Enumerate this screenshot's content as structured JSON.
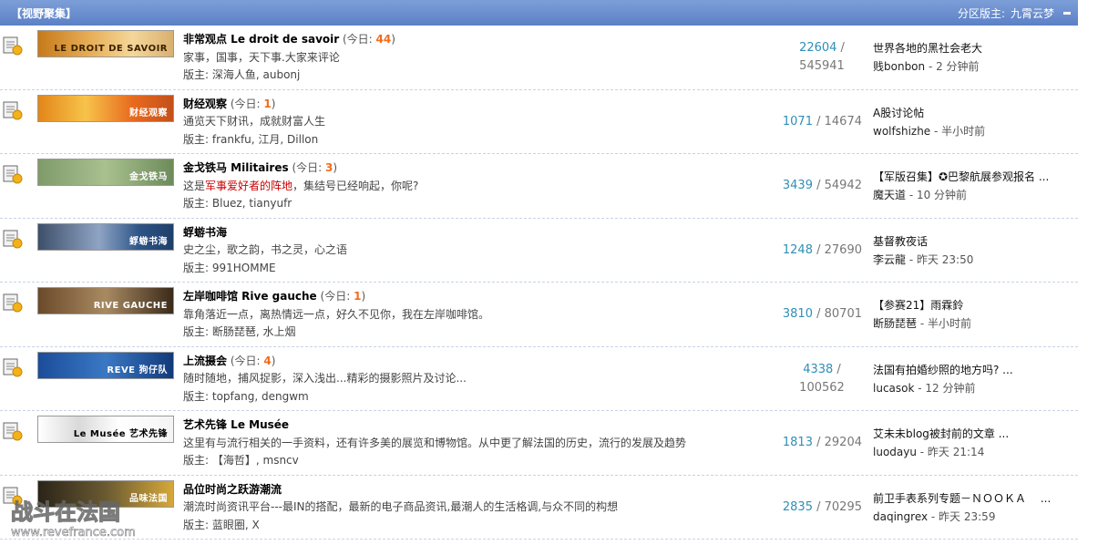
{
  "category": {
    "title": "【视野聚集】",
    "moderators_label": "分区版主:",
    "moderators": "九霄云梦"
  },
  "forums": [
    {
      "name": "非常观点 Le droit de savoir",
      "today_prefix": "(今日: ",
      "today": "44",
      "today_suffix": ")",
      "desc_parts": [
        "家事，国事，天下事.大家来评论"
      ],
      "mods_label": "版主:",
      "mods": "深海人鱼, aubonj",
      "topics": "22604",
      "posts": "545941",
      "last_title": "世界各地的黑社会老大",
      "last_user": "贱bonbon",
      "last_time": "- 2 分钟前",
      "banner_text": "LE DROIT DE SAVOIR"
    },
    {
      "name": "财经观察",
      "today_prefix": "(今日: ",
      "today": "1",
      "today_suffix": ")",
      "desc_parts": [
        "通览天下财讯，成就财富人生"
      ],
      "mods_label": "版主:",
      "mods": "frankfu, 江月, Dillon",
      "topics": "1071",
      "posts": "14674",
      "last_title": "A股讨论帖",
      "last_user": "wolfshizhe",
      "last_time": "- 半小时前",
      "banner_text": "财经观察"
    },
    {
      "name": "金戈铁马 Militaires",
      "today_prefix": "(今日: ",
      "today": "3",
      "today_suffix": ")",
      "desc_parts": [
        "这是",
        "军事爱好者的阵地",
        "，集结号已经响起，你呢?"
      ],
      "mods_label": "版主:",
      "mods": "Bluez, tianyufr",
      "topics": "3439",
      "posts": "54942",
      "last_title": "【军版召集】✪巴黎航展参观报名 ...",
      "last_user": "魔天道",
      "last_time": "- 10 分钟前",
      "banner_text": "金戈铁马"
    },
    {
      "name": "蜉蝣书海",
      "today_prefix": "",
      "today": "",
      "today_suffix": "",
      "desc_parts": [
        "史之尘，歌之韵，书之灵，心之语"
      ],
      "mods_label": "版主:",
      "mods": "991HOMME",
      "topics": "1248",
      "posts": "27690",
      "last_title": "基督教夜话",
      "last_user": "李云龍",
      "last_time": "- 昨天 23:50",
      "banner_text": "蜉蝣书海"
    },
    {
      "name": "左岸咖啡馆 Rive gauche",
      "today_prefix": "(今日: ",
      "today": "1",
      "today_suffix": ")",
      "desc_parts": [
        "靠角落近一点，离热情远一点，好久不见你，我在左岸咖啡馆。"
      ],
      "mods_label": "版主:",
      "mods": "断肠琵琶, 水上烟",
      "topics": "3810",
      "posts": "80701",
      "last_title": "【参赛21】雨霖鈴",
      "last_user": "断肠琵琶",
      "last_time": "- 半小时前",
      "banner_text": "RIVE GAUCHE"
    },
    {
      "name": "上流摄会",
      "today_prefix": "(今日: ",
      "today": "4",
      "today_suffix": ")",
      "desc_parts": [
        "随时随地，捕风捉影，深入浅出...精彩的摄影照片及讨论..."
      ],
      "mods_label": "版主:",
      "mods": "topfang, dengwm",
      "topics": "4338",
      "posts": "100562",
      "last_title": "法国有拍婚纱照的地方吗? ...",
      "last_user": "lucasok",
      "last_time": "- 12 分钟前",
      "banner_text": "REVE 狗仔队"
    },
    {
      "name": "艺术先锋 Le Musée",
      "today_prefix": "",
      "today": "",
      "today_suffix": "",
      "desc_parts": [
        "这里有与流行相关的一手资料，还有许多美的展览和博物馆。从中更了解法国的历史，流行的发展及趋势"
      ],
      "mods_label": "版主:",
      "mods": "【海哲】, msncv",
      "topics": "1813",
      "posts": "29204",
      "last_title": "艾未未blog被封前的文章 ...",
      "last_user": "luodayu",
      "last_time": "- 昨天 21:14",
      "banner_text": "Le Musée 艺术先锋"
    },
    {
      "name": "品位时尚之跃游潮流",
      "today_prefix": "",
      "today": "",
      "today_suffix": "",
      "desc_parts": [
        "潮流时尚资讯平台---最IN的搭配，最新的电子商品资讯,最潮人的生活格调,与众不同的构想"
      ],
      "mods_label": "版主:",
      "mods": "蓝眼圈, X",
      "topics": "2835",
      "posts": "70295",
      "last_title": "前卫手表系列专题－ＮＯＯＫＡ　 ...",
      "last_user": "daqingrex",
      "last_time": "- 昨天 23:59",
      "banner_text": "品味法国"
    }
  ],
  "watermark": {
    "line1": "战斗在法国",
    "line2": "www.revefrance.com"
  }
}
